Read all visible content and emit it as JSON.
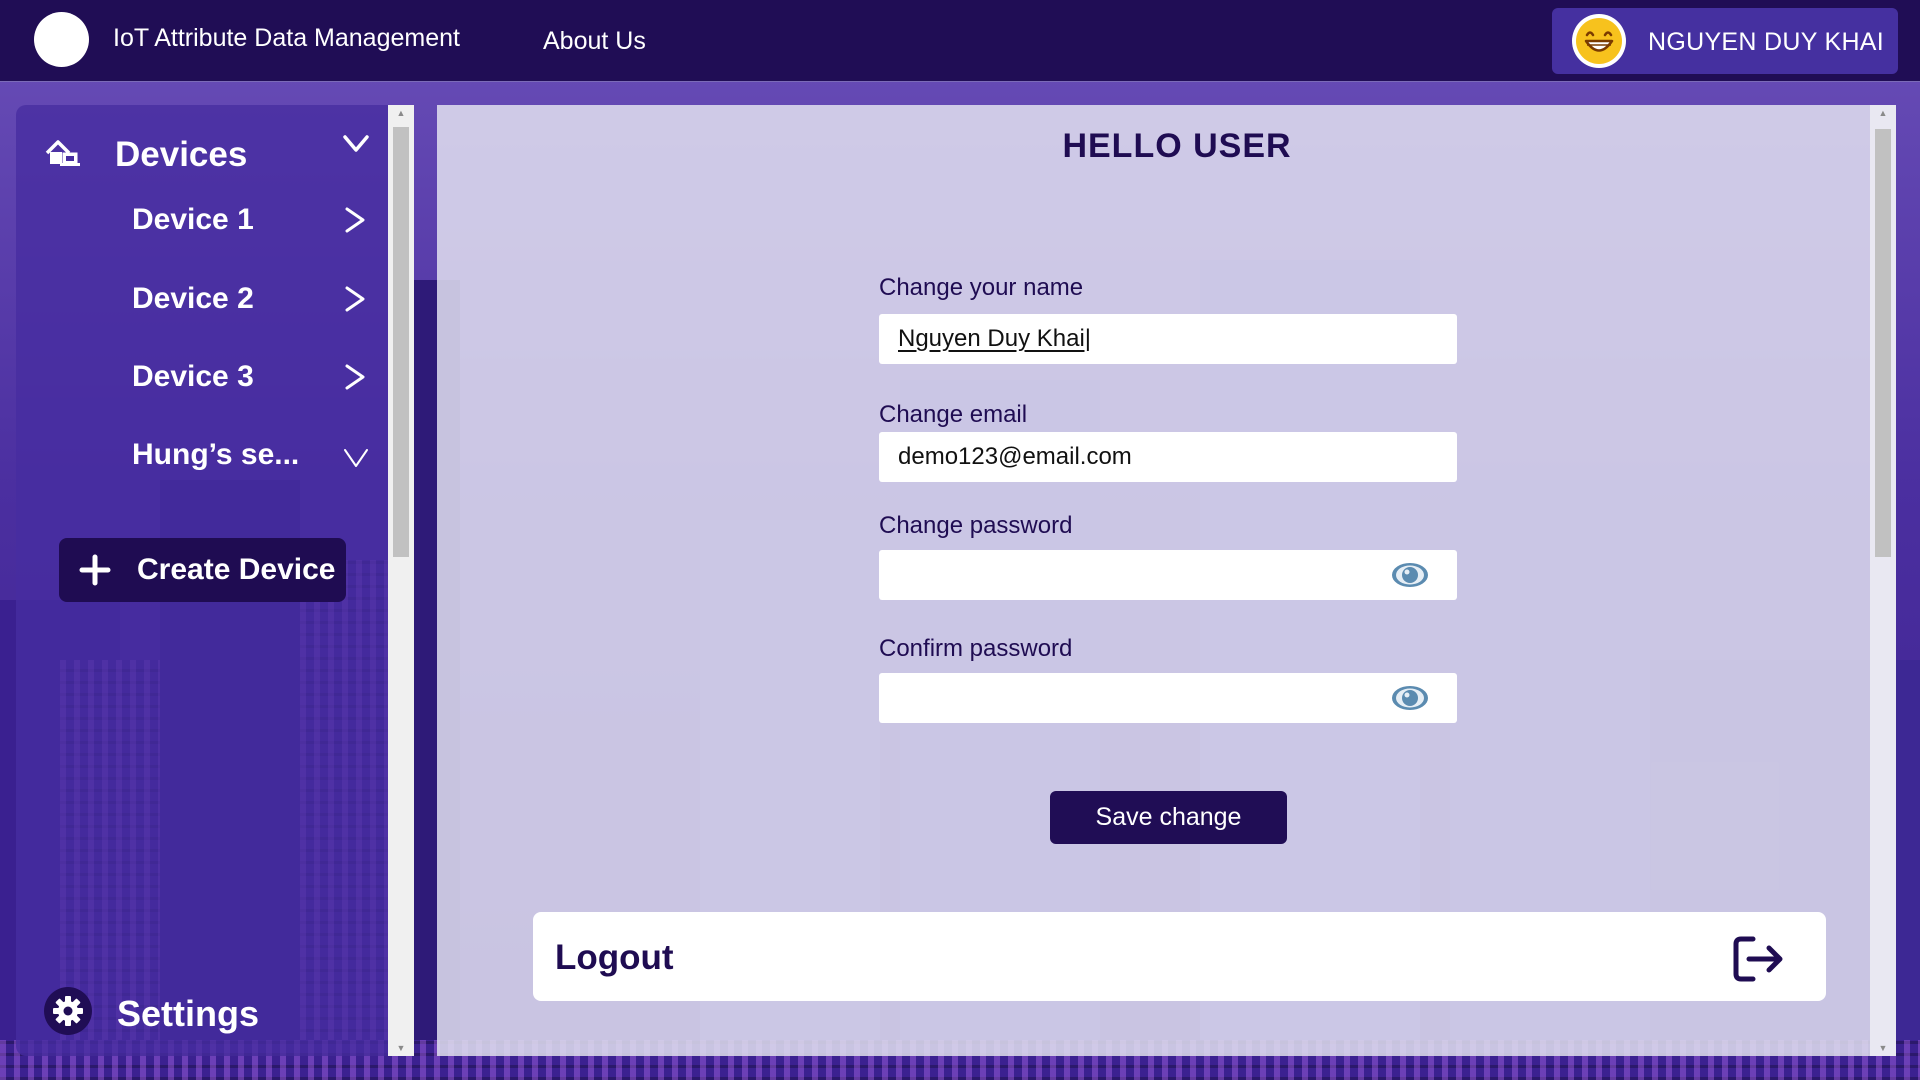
{
  "header": {
    "app_title": "IoT Attribute Data Management",
    "nav_about": "About Us",
    "user_name": "NGUYEN DUY KHAI",
    "avatar_icon": "smiley-face-icon"
  },
  "sidebar": {
    "heading": "Devices",
    "heading_icon": "devices-house-icon",
    "items": [
      {
        "label": "Device 1",
        "chevron": ">"
      },
      {
        "label": "Device 2",
        "chevron": ">"
      },
      {
        "label": "Device 3",
        "chevron": ">"
      },
      {
        "label": "Hung’s se...",
        "chevron": "v"
      }
    ],
    "create_button": "Create Device",
    "settings_label": "Settings"
  },
  "main": {
    "greeting": "HELLO USER",
    "name_label": "Change your name",
    "name_value": "Nguyen Duy Khai|",
    "email_label": "Change email",
    "email_value": "demo123@email.com",
    "password_label": "Change password",
    "password_value": "",
    "confirm_label": "Confirm password",
    "confirm_value": "",
    "save_button": "Save change",
    "logout_label": "Logout"
  },
  "colors": {
    "primary_dark": "#200d55",
    "sidebar": "#462da0",
    "accent_eye": "#5b8bb0"
  }
}
